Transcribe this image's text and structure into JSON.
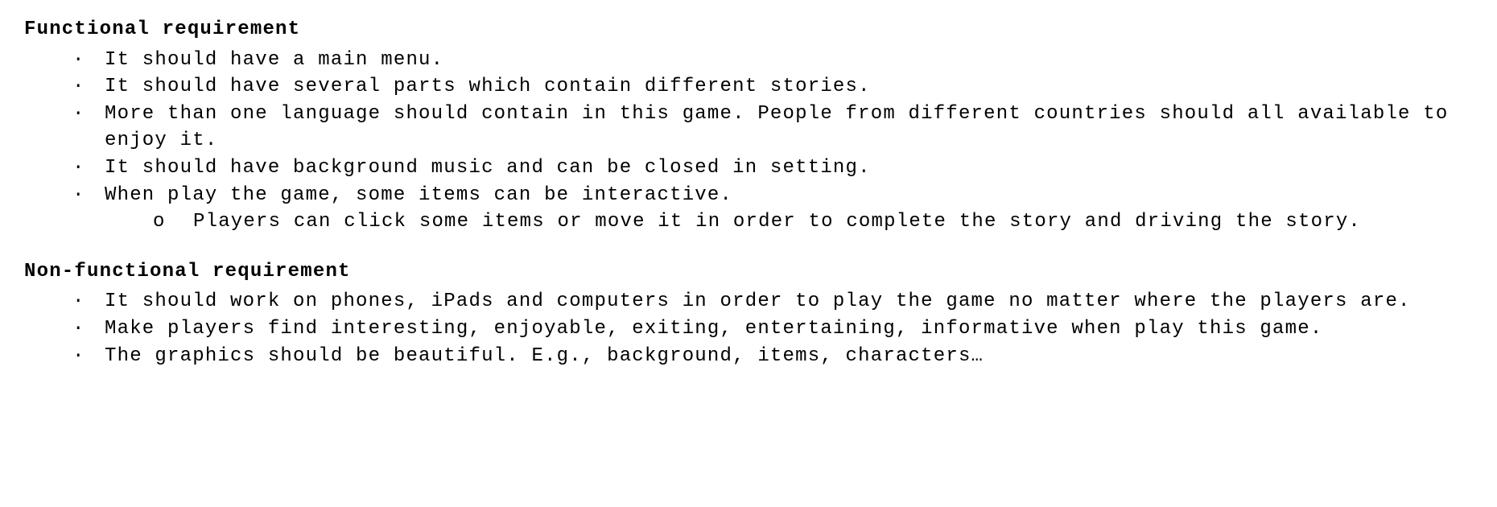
{
  "sections": [
    {
      "heading": "Functional requirement",
      "items": [
        {
          "text": "It should have a main menu."
        },
        {
          "text": "It should have several parts which contain different stories."
        },
        {
          "text": "More than one language should contain in this game. People from different countries should all available to enjoy it."
        },
        {
          "text": "It should have background music and can be closed in setting."
        },
        {
          "text": "When play the game, some items can be interactive.",
          "subitems": [
            {
              "text": "Players can click some items or move it in order to complete the story and driving the story."
            }
          ]
        }
      ]
    },
    {
      "heading": "Non-functional requirement",
      "items": [
        {
          "text": "It should work on phones, iPads and computers in order to play the game no matter where the players are."
        },
        {
          "text": "Make players find interesting, enjoyable, exiting, entertaining, informative when play this game."
        },
        {
          "text": "The graphics should be beautiful. E.g., background, items, characters…"
        }
      ]
    }
  ]
}
